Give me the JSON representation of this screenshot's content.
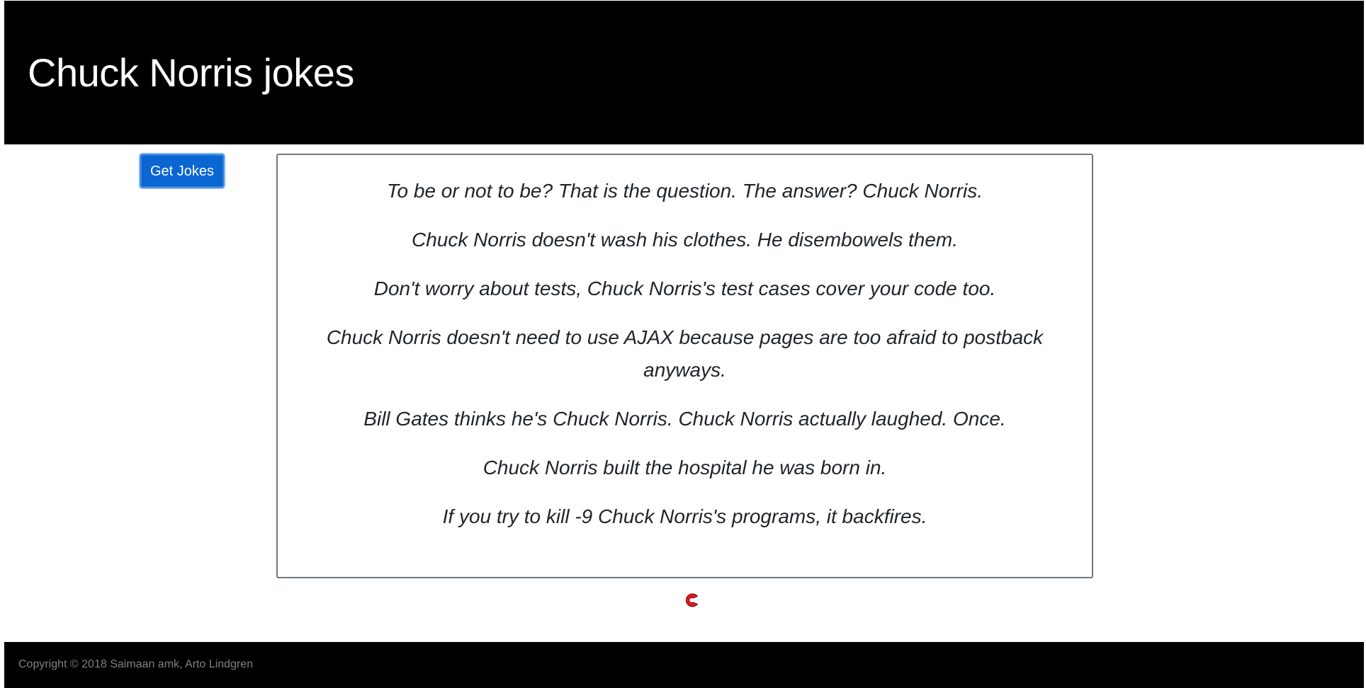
{
  "header": {
    "title": "Chuck Norris jokes"
  },
  "actions": {
    "get_jokes_label": "Get Jokes"
  },
  "jokes": [
    "To be or not to be? That is the question. The answer? Chuck Norris.",
    "Chuck Norris doesn't wash his clothes. He disembowels them.",
    "Don't worry about tests, Chuck Norris's test cases cover your code too.",
    "Chuck Norris doesn't need to use AJAX because pages are too afraid to postback anyways.",
    "Bill Gates thinks he's Chuck Norris. Chuck Norris actually laughed. Once.",
    "Chuck Norris built the hospital he was born in.",
    "If you try to kill -9 Chuck Norris's programs, it backfires."
  ],
  "loading_indicator": {
    "icon": "loading-spinner-icon",
    "color": "#e8141b"
  },
  "footer": {
    "copyright": "Copyright © 2018 Saimaan amk, Arto Lindgren"
  },
  "colors": {
    "header_bg": "#000000",
    "button_bg": "#0a66d0",
    "box_border": "#6f7780",
    "footer_text": "#7b8288"
  }
}
